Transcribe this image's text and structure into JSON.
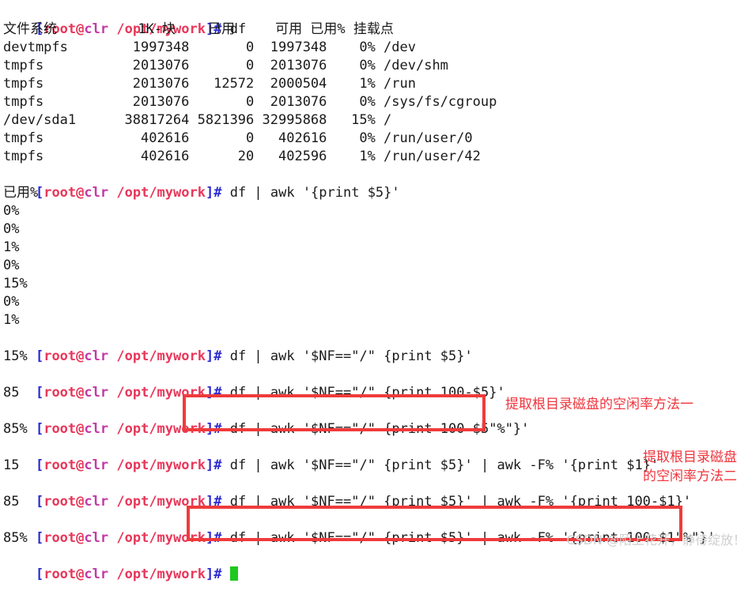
{
  "prompt": {
    "open": "[",
    "user": "root",
    "at": "@",
    "host": "clr",
    "path": "/opt/mywork",
    "close": "]#"
  },
  "commands": {
    "df": "df",
    "awk5": "df | awk '{print $5}'",
    "nf5": "df | awk '$NF==\"/\" {print $5}'",
    "nf100": "df | awk '$NF==\"/\" {print 100-$5}'",
    "nf100pct": "df | awk '$NF==\"/\" {print 100-$5\"%\"}'",
    "pipe1": "df | awk '$NF==\"/\" {print $5}' | awk -F% '{print $1}'",
    "pipe100": "df | awk '$NF==\"/\" {print $5}' | awk -F% '{print 100-$1}'",
    "pipe100pct": "df | awk '$NF==\"/\" {print $5}' | awk -F% '{print 100-$1\"%\"}'"
  },
  "df_table": {
    "header": "文件系统          1K-块    已用     可用 已用% 挂载点",
    "rows": [
      "devtmpfs        1997348       0  1997348    0% /dev",
      "tmpfs           2013076       0  2013076    0% /dev/shm",
      "tmpfs           2013076   12572  2000504    1% /run",
      "tmpfs           2013076       0  2013076    0% /sys/fs/cgroup",
      "/dev/sda1      38817264 5821396 32995868   15% /",
      "tmpfs            402616       0   402616    0% /run/user/0",
      "tmpfs            402616      20   402596    1% /run/user/42"
    ]
  },
  "awk5_output": [
    "已用%",
    "0%",
    "0%",
    "1%",
    "0%",
    "15%",
    "0%",
    "1%"
  ],
  "outputs": {
    "nf5": "15%",
    "nf100": "85",
    "nf100pct": "85%",
    "pipe1": "15",
    "pipe100": "85",
    "pipe100pct": "85%"
  },
  "annotations": {
    "method1": "提取根目录磁盘的空闲率方法一",
    "method2_line1": "提取根目录磁盘",
    "method2_line2": "的空闲率方法二"
  },
  "watermark": "CSDN @陌上花开，静待绽放！",
  "colors": {
    "prompt_bracket": "#2a2ad0",
    "prompt_user": "#e8375a",
    "prompt_host": "#c33aa6",
    "highlight_box": "#ef3b3b",
    "cursor": "#1ec81e"
  }
}
